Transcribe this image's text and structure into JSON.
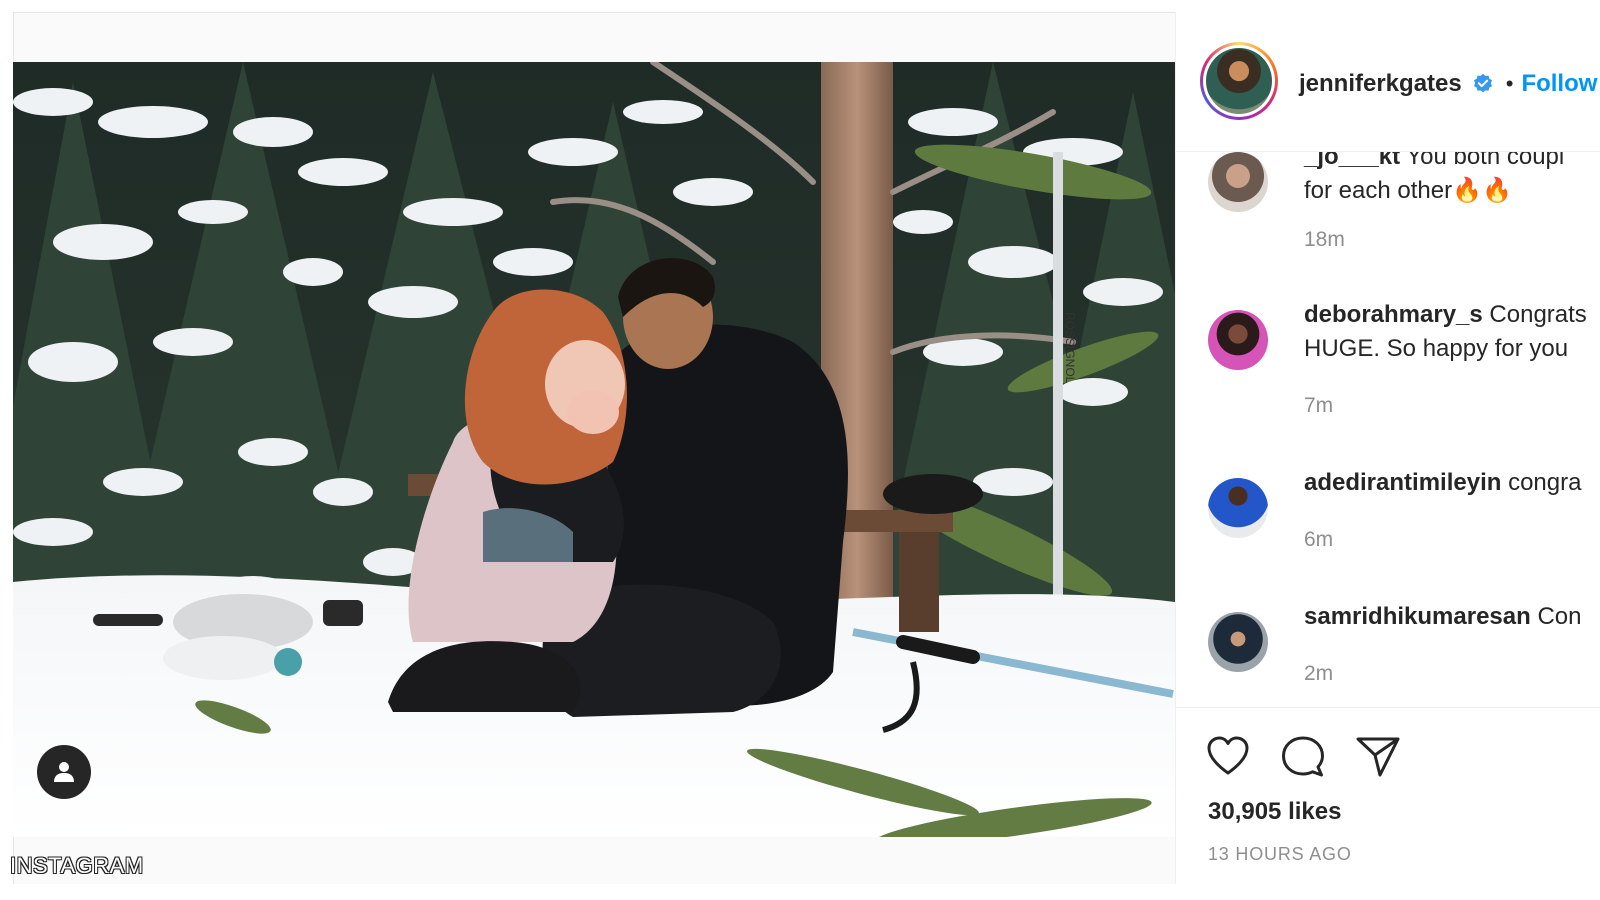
{
  "post": {
    "username": "jenniferkgates",
    "follow_label": "Follow",
    "separator": "•",
    "verified_icon": "verified-badge-icon",
    "likes": "30,905 likes",
    "time_ago": "13 HOURS AGO"
  },
  "comments": [
    {
      "username": "_jo___kt",
      "text": "You both coupl",
      "text_line2": "for each other🔥🔥",
      "time": "18m"
    },
    {
      "username": "deborahmary_s",
      "text": "Congrats",
      "text_line2": "HUGE. So happy for you",
      "time": "7m"
    },
    {
      "username": "adedirantimileyin",
      "text": "congra",
      "text_line2": "",
      "time": "6m"
    },
    {
      "username": "samridhikumaresan",
      "text": "Con",
      "text_line2": "",
      "time": "2m"
    }
  ],
  "actions": {
    "like_icon": "heart-icon",
    "comment_icon": "comment-bubble-icon",
    "share_icon": "paper-plane-icon"
  },
  "media": {
    "user_tag_icon": "user-tag-icon",
    "watermark": "INSTAGRAM",
    "ski_pole_text": "ROSSIGNOL"
  },
  "colors": {
    "link_blue": "#0095f6",
    "verified_blue": "#3897f0",
    "secondary_text": "#8e8e8e",
    "border": "#efefef"
  }
}
